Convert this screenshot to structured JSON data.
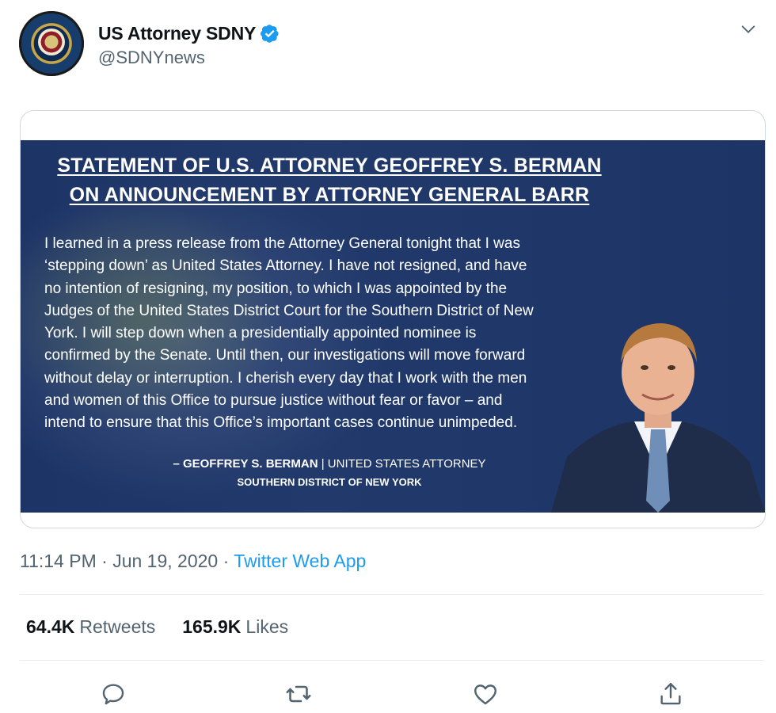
{
  "tweet": {
    "author": {
      "display_name": "US Attorney SDNY",
      "handle": "@SDNYnews",
      "verified": true,
      "avatar_icon": "doj-seal-avatar"
    },
    "media": {
      "title_line1": "STATEMENT OF U.S. ATTORNEY GEOFFREY S. BERMAN",
      "title_line2": "ON ANNOUNCEMENT BY ATTORNEY GENERAL BARR",
      "body_lines": [
        "I learned in a press release from the Attorney General tonight that I was",
        "‘stepping down’ as United States Attorney.  I have not resigned, and have",
        "no intention of resigning, my position, to which I was appointed by the",
        "Judges of the United States District Court for the Southern District of New",
        "York.  I will step down when a presidentially appointed nominee is",
        "confirmed by the Senate.  Until then, our investigations will move forward",
        "without delay or interruption.  I cherish every day that I work with the men",
        "and women of this Office to pursue justice without fear or favor – and",
        "intend to ensure that this Office’s important cases continue unimpeded."
      ],
      "signature_name": "– GEOFFREY S. BERMAN",
      "signature_separator": "|",
      "signature_role": "UNITED STATES ATTORNEY",
      "signature_district": "SOUTHERN DISTRICT OF NEW YORK"
    },
    "time": "11:14 PM",
    "date": "Jun 19, 2020",
    "separator": "·",
    "source": "Twitter Web App",
    "stats": {
      "retweets_value": "64.4K",
      "retweets_label": "Retweets",
      "likes_value": "165.9K",
      "likes_label": "Likes"
    }
  },
  "colors": {
    "link": "#1d9bf0",
    "muted": "#536471",
    "text": "#0f1419",
    "statement_bg": "#1d3466"
  },
  "icons": [
    "chevron-down-icon",
    "verified-badge-icon",
    "reply-icon",
    "retweet-icon",
    "like-icon",
    "share-icon"
  ]
}
